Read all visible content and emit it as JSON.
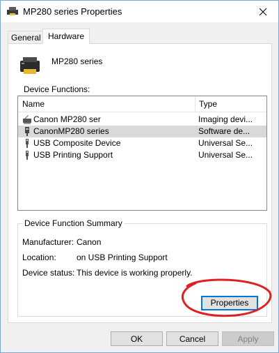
{
  "window": {
    "title": "MP280 series Properties"
  },
  "tabs": [
    {
      "label": "General"
    },
    {
      "label": "Hardware"
    }
  ],
  "device": {
    "name": "MP280 series"
  },
  "device_functions": {
    "label": "Device Functions:",
    "columns": [
      "Name",
      "Type"
    ],
    "rows": [
      {
        "name": "Canon MP280 ser",
        "type": "Imaging devi...",
        "icon": "scanner-icon"
      },
      {
        "name": "CanonMP280 series",
        "type": "Software de...",
        "icon": "usb-device-icon"
      },
      {
        "name": "USB Composite Device",
        "type": "Universal Se...",
        "icon": "usb-icon"
      },
      {
        "name": "USB Printing Support",
        "type": "Universal Se...",
        "icon": "usb-icon"
      }
    ]
  },
  "summary": {
    "title": "Device Function Summary",
    "manufacturer_label": "Manufacturer:",
    "manufacturer_value": "Canon",
    "location_label": "Location:",
    "location_value": "on USB Printing Support",
    "status_label": "Device status:",
    "status_value": "This device is working properly.",
    "properties_button": "Properties"
  },
  "footer": {
    "ok": "OK",
    "cancel": "Cancel",
    "apply": "Apply"
  },
  "colors": {
    "accent": "#0078d7",
    "annotation": "#e02020",
    "selected_row": "#d9d9d9"
  }
}
